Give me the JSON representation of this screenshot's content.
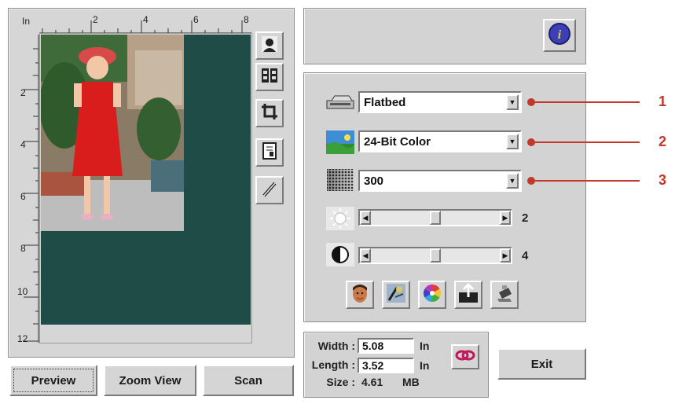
{
  "ruler": {
    "unit": "In",
    "top_ticks": [
      "2",
      "4",
      "6",
      "8"
    ],
    "left_ticks": [
      "2",
      "4",
      "6",
      "8",
      "10",
      "12"
    ]
  },
  "side_tools": [
    {
      "icon": "portrait-silhouette-icon"
    },
    {
      "icon": "film-reels-icon"
    },
    {
      "icon": "crop-icon"
    },
    {
      "icon": "document-icon"
    },
    {
      "icon": "pen-icon"
    }
  ],
  "buttons": {
    "preview": "Preview",
    "zoom_view": "Zoom View",
    "scan": "Scan",
    "exit": "Exit"
  },
  "info_icon": "info-icon",
  "dropdowns": {
    "scan_source": {
      "value": "Flatbed",
      "icon": "flatbed-scanner-icon"
    },
    "image_type": {
      "value": "24-Bit Color",
      "icon": "landscape-color-icon"
    },
    "resolution": {
      "value": "300",
      "icon": "halftone-dots-icon"
    }
  },
  "sliders": {
    "brightness": {
      "value": "2",
      "level": 0.5,
      "icon": "sun-icon"
    },
    "contrast": {
      "value": "4",
      "level": 0.5,
      "icon": "contrast-icon"
    }
  },
  "tool_row": [
    {
      "icon": "face-icon"
    },
    {
      "icon": "auto-adjust-icon"
    },
    {
      "icon": "color-wheel-icon"
    },
    {
      "icon": "highlight-shadow-icon"
    },
    {
      "icon": "eraser-icon"
    }
  ],
  "size": {
    "width_label": "Width :",
    "width_value": "5.08",
    "width_unit": "In",
    "length_label": "Length :",
    "length_value": "3.52",
    "length_unit": "In",
    "size_label": "Size :",
    "size_value": "4.61",
    "size_unit": "MB"
  },
  "callouts": [
    "1",
    "2",
    "3"
  ],
  "colors": {
    "scan_bed": "#1f4c46",
    "callout": "#c0392b",
    "panel": "#d3d3d3"
  }
}
